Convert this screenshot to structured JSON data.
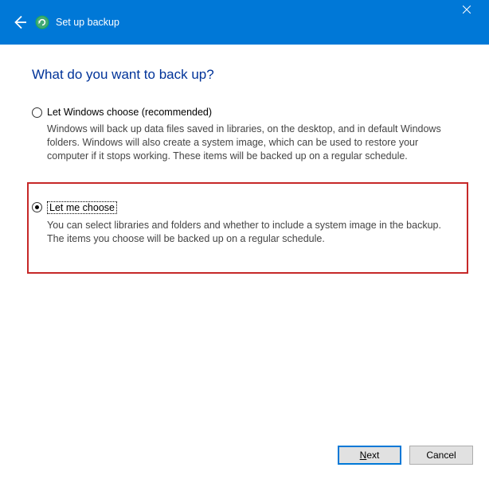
{
  "titlebar": {
    "title": "Set up backup"
  },
  "heading": "What do you want to back up?",
  "options": {
    "windows_choose": {
      "label": "Let Windows choose (recommended)",
      "desc": "Windows will back up data files saved in libraries, on the desktop, and in default Windows folders. Windows will also create a system image, which can be used to restore your computer if it stops working. These items will be backed up on a regular schedule.",
      "selected": false
    },
    "let_me_choose": {
      "label": "Let me choose",
      "desc": "You can select libraries and folders and whether to include a system image in the backup. The items you choose will be backed up on a regular schedule.",
      "selected": true
    }
  },
  "footer": {
    "next": "Next",
    "cancel": "Cancel"
  }
}
